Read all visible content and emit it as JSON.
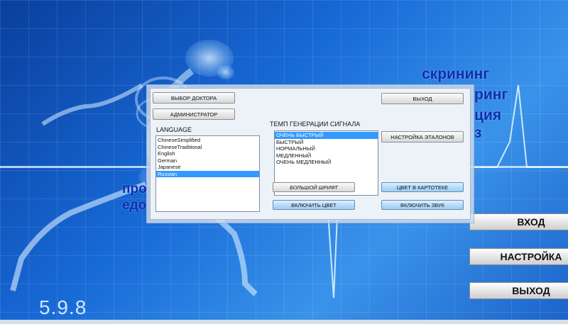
{
  "background_text": {
    "line1": "скрининг",
    "line2": "ринг",
    "line3": "ция",
    "line4": "з",
    "left1": "про",
    "left2": "едо"
  },
  "version": "5.9.8",
  "main_buttons": {
    "enter": "ВХОД",
    "settings": "НАСТРОЙКА",
    "exit": "ВЫХОД"
  },
  "dialog": {
    "doctor_select": "ВЫБОР ДОКТОРА",
    "admin": "АДМИНИСТРАТОР",
    "exit": "ВЫХОД",
    "language_label": "LANGUAGE",
    "languages": [
      "ChineseSimplified",
      "ChineseTraditional",
      "English",
      "German",
      "Japanese",
      "Russian"
    ],
    "selected_language": "Russian",
    "signal_label": "ТЕМП ГЕНЕРАЦИИ СИГНАЛА",
    "signal_speeds": [
      "ОЧЕНЬ БЫСТРЫЙ",
      "БЫСТРЫЙ",
      "НОРМАЛЬНЫЙ",
      "МЕДЛЕННЫЙ",
      "ОЧЕНЬ МЕДЛЕННЫЙ"
    ],
    "selected_speed": "ОЧЕНЬ БЫСТРЫЙ",
    "etalon_settings": "НАСТРОЙКА ЭТАЛОНОВ",
    "big_font": "БОЛЬШОЙ ШРИФТ",
    "color_in_catalog": "ЦВЕТ В КАРТОТЕКЕ",
    "enable_color": "ВКЛЮЧИТЬ ЦВЕТ",
    "enable_sound": "ВКЛЮЧИТЬ ЗВУК"
  },
  "colors": {
    "selection": "#3399ff",
    "background_blue": "#1769d6",
    "bg_text": "#0d2fb0"
  }
}
